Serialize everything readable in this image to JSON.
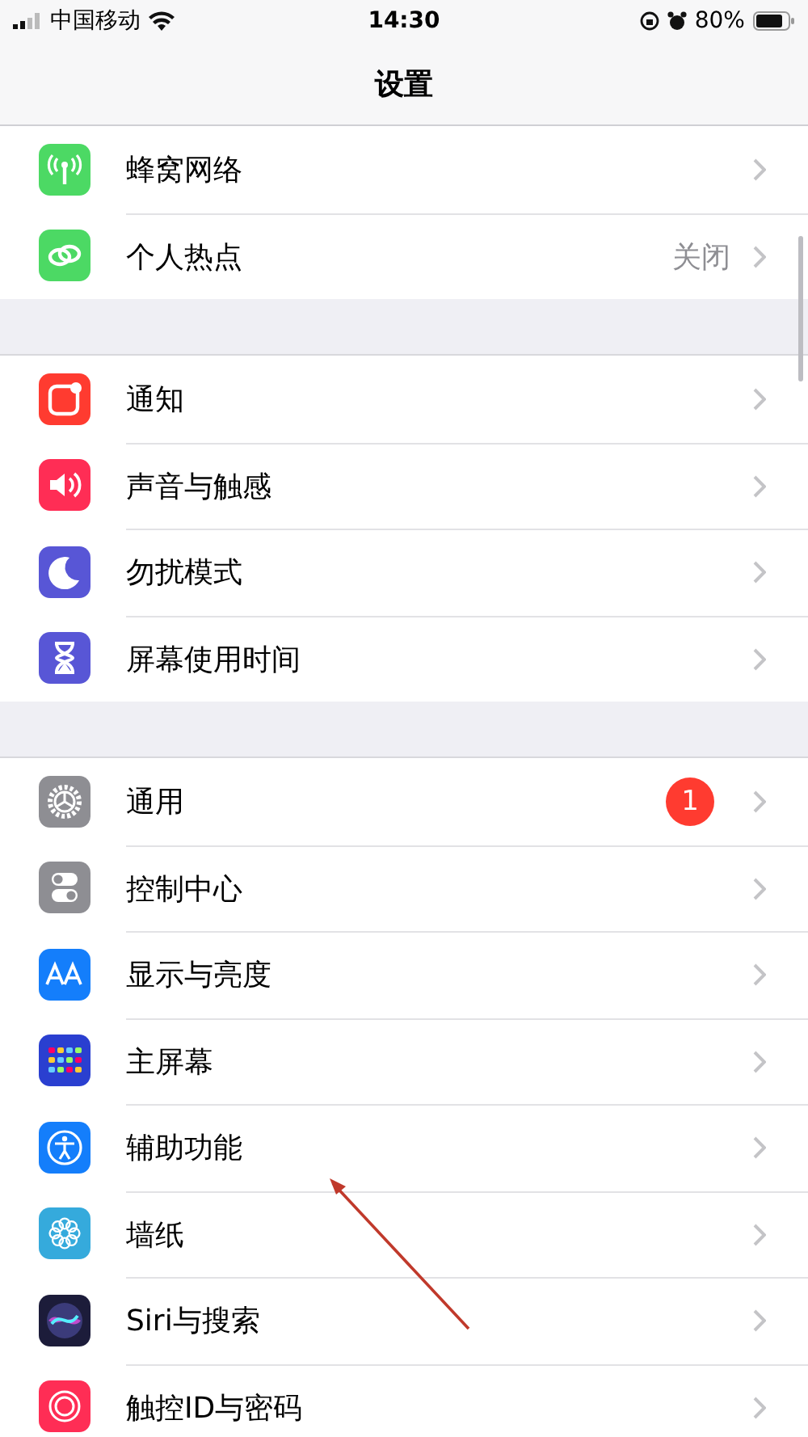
{
  "status_bar": {
    "carrier": "中国移动",
    "time": "14:30",
    "battery": "80%"
  },
  "nav_bar": {
    "title": "设置"
  },
  "groups": [
    {
      "items": [
        {
          "label": "蜂窝网络"
        },
        {
          "label": "个人热点",
          "value": "关闭"
        }
      ]
    },
    {
      "items": [
        {
          "label": "通知"
        },
        {
          "label": "声音与触感"
        },
        {
          "label": "勿扰模式"
        },
        {
          "label": "屏幕使用时间"
        }
      ]
    },
    {
      "items": [
        {
          "label": "通用",
          "badge": "1"
        },
        {
          "label": "控制中心"
        },
        {
          "label": "显示与亮度"
        },
        {
          "label": "主屏幕"
        },
        {
          "label": "辅助功能"
        },
        {
          "label": "墙纸"
        },
        {
          "label": "Siri与搜索"
        },
        {
          "label": "触控ID与密码"
        }
      ]
    }
  ]
}
